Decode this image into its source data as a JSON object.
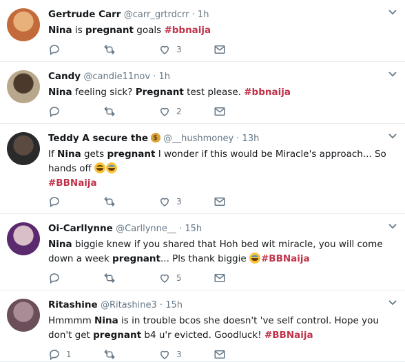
{
  "tweets": [
    {
      "name": "Gertrude Carr",
      "handle": "@carr_grtrdcrr",
      "time": "1h",
      "segments": [
        [
          "b",
          "Nina"
        ],
        [
          "t",
          " is "
        ],
        [
          "b",
          "pregnant"
        ],
        [
          "t",
          " goals "
        ],
        [
          "h",
          "#bbnaija"
        ]
      ],
      "reply_count": "",
      "retweet_count": "",
      "like_count": "3",
      "avatar_colors": [
        "#c26a3a",
        "#e8b07a"
      ]
    },
    {
      "name": "Candy",
      "handle": "@candie11nov",
      "time": "1h",
      "segments": [
        [
          "b",
          "Nina"
        ],
        [
          "t",
          " feeling sick? "
        ],
        [
          "b",
          "Pregnant"
        ],
        [
          "t",
          " test please. "
        ],
        [
          "h",
          "#bbnaija"
        ]
      ],
      "reply_count": "",
      "retweet_count": "",
      "like_count": "2",
      "avatar_colors": [
        "#b8a78c",
        "#4b3a2c"
      ]
    },
    {
      "name": "Teddy A secure the",
      "handle": "@__hushmoney",
      "time": "13h",
      "segments": [
        [
          "t",
          "If "
        ],
        [
          "b",
          "Nina"
        ],
        [
          "t",
          " gets "
        ],
        [
          "b",
          "pregnant"
        ],
        [
          "t",
          " I wonder if this would be Miracle's approach... So hands off "
        ],
        [
          "e",
          "laugh"
        ],
        [
          "e",
          "cry"
        ],
        [
          "br",
          ""
        ],
        [
          "h",
          "#BBNaija"
        ]
      ],
      "reply_count": "",
      "retweet_count": "",
      "like_count": "3",
      "avatar_colors": [
        "#2a2a2a",
        "#5a4a40"
      ]
    },
    {
      "name": "Oi-Carllynne",
      "handle": "@Carllynne__",
      "time": "15h",
      "segments": [
        [
          "b",
          "Nina"
        ],
        [
          "t",
          " biggie knew if you shared that Hoh bed wit miracle, you will come down a week "
        ],
        [
          "b",
          "pregnant"
        ],
        [
          "t",
          "... Pls thank biggie "
        ],
        [
          "e",
          "cry"
        ],
        [
          "h",
          "#BBNaija"
        ]
      ],
      "reply_count": "",
      "retweet_count": "",
      "like_count": "5",
      "avatar_colors": [
        "#5b2a6e",
        "#d9c0c8"
      ]
    },
    {
      "name": "Ritashine",
      "handle": "@Ritashine3",
      "time": "15h",
      "segments": [
        [
          "t",
          "Hmmmm "
        ],
        [
          "b",
          "Nina"
        ],
        [
          "t",
          " is in trouble bcos she doesn't 've self control. Hope you don't get "
        ],
        [
          "b",
          "pregnant"
        ],
        [
          "t",
          " b4 u'r evicted. Goodluck! "
        ],
        [
          "h",
          "#BBNaija"
        ]
      ],
      "reply_count": "1",
      "retweet_count": "",
      "like_count": "3",
      "avatar_colors": [
        "#6a4e5a",
        "#a88d96"
      ]
    }
  ],
  "icons": {
    "reply": "reply-icon",
    "retweet": "retweet-icon",
    "like": "heart-icon",
    "message": "envelope-icon",
    "caret": "chevron-down-icon"
  },
  "colors": {
    "hashtag": "#c1334a",
    "muted": "#657786",
    "border": "#e6ecf0"
  }
}
